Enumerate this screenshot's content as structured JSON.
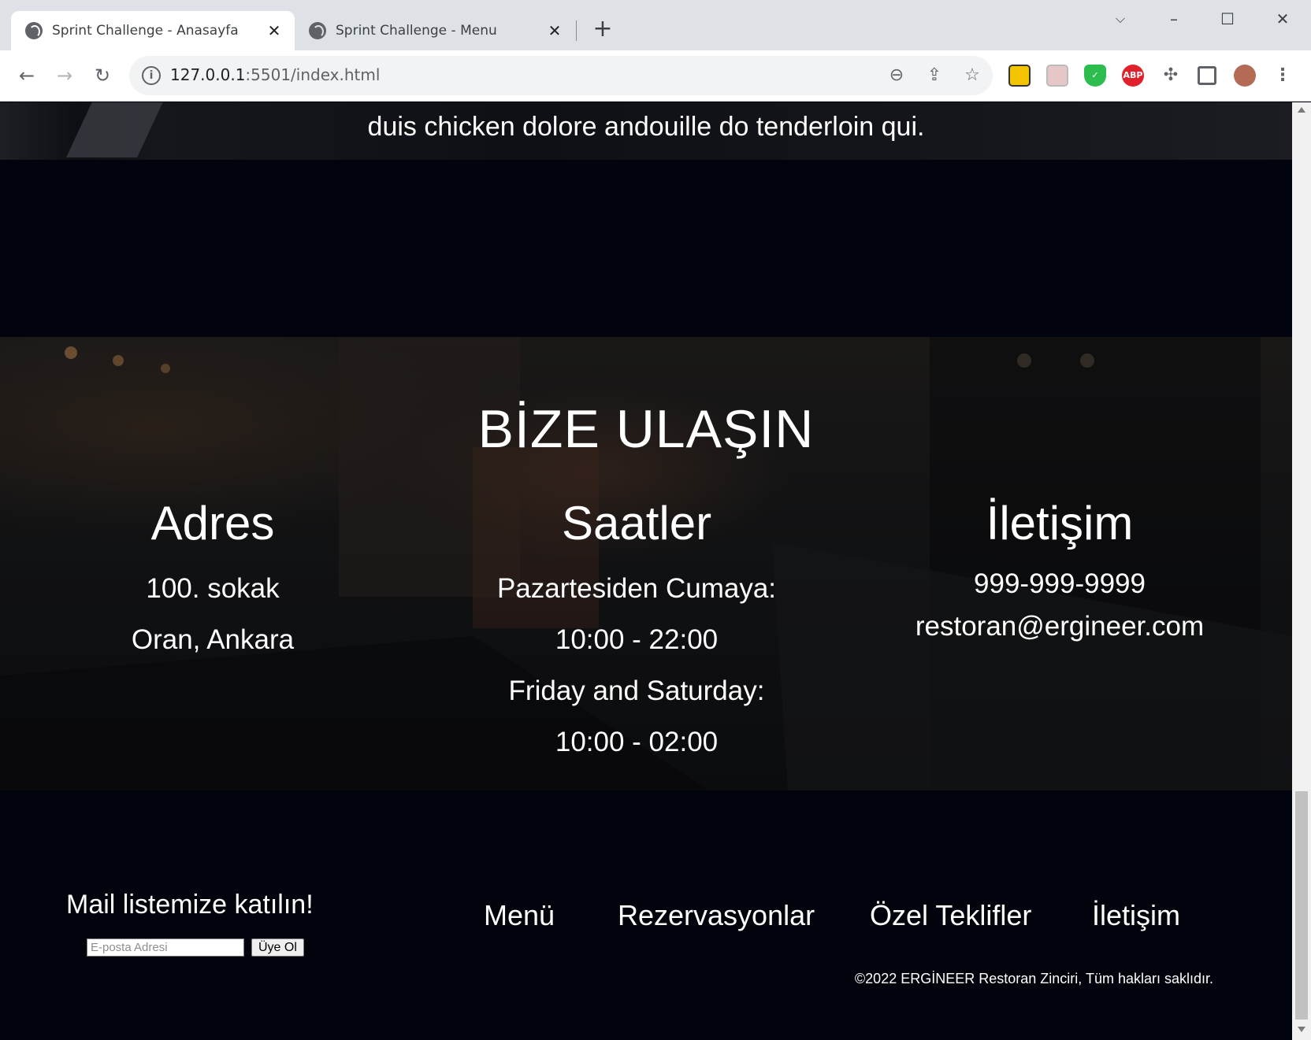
{
  "browser": {
    "tabs": [
      {
        "title": "Sprint Challenge - Anasayfa",
        "active": true
      },
      {
        "title": "Sprint Challenge - Menu",
        "active": false
      }
    ],
    "url_host": "127.0.0.1",
    "url_rest": ":5501/index.html",
    "extensions": [
      "folder-extension-icon",
      "reader-extension-icon",
      "shield-extension-icon",
      "adblock-extension-icon",
      "puzzle-extension-icon"
    ],
    "adblock_label": "ABP"
  },
  "about": {
    "text": "duis chicken dolore andouille do tenderloin qui."
  },
  "contact": {
    "heading": "BİZE ULAŞIN",
    "address": {
      "title": "Adres",
      "lines": [
        "100. sokak",
        "Oran, Ankara"
      ]
    },
    "hours": {
      "title": "Saatler",
      "lines": [
        "Pazartesiden Cumaya:",
        "10:00 - 22:00",
        "Friday and Saturday:",
        "10:00 - 02:00"
      ]
    },
    "contact_info": {
      "title": "İletişim",
      "phone": "999-999-9999",
      "email": "restoran@ergineer.com"
    }
  },
  "footer": {
    "newsletter_title": "Mail listemize katılın!",
    "email_placeholder": "E-posta Adresi",
    "subscribe_label": "Üye Ol",
    "nav": [
      "Menü",
      "Rezervasyonlar",
      "Özel Teklifler",
      "İletişim"
    ],
    "copyright": "©2022 ERGİNEER Restoran Zinciri, Tüm hakları saklıdır."
  },
  "colors": {
    "page_bg": "#02040d",
    "text": "#ffffff",
    "chrome_bg": "#dee1e6"
  }
}
